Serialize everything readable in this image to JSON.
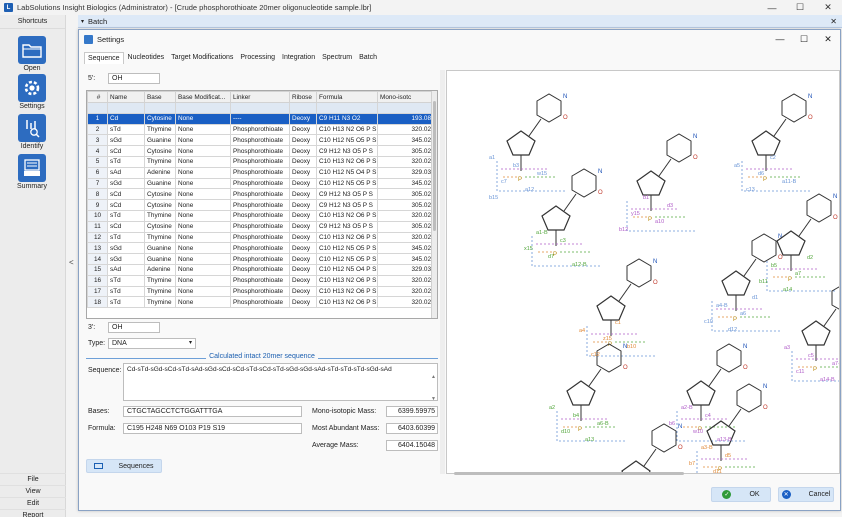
{
  "window": {
    "title": "LabSolutions Insight Biologics (Administrator) - [Crude phosphorothioate 20mer oligonucleotide sample.lbr]",
    "controls": [
      "—",
      "☐",
      "✕"
    ]
  },
  "sidebar": {
    "header": "Shortcuts",
    "items": [
      {
        "label": "Open",
        "icon": "folder-icon"
      },
      {
        "label": "Settings",
        "icon": "gear-icon"
      },
      {
        "label": "Identify",
        "icon": "identify-icon"
      },
      {
        "label": "Summary",
        "icon": "summary-icon"
      }
    ],
    "collapse_glyph": "<",
    "menu": [
      "File",
      "View",
      "Edit",
      "Report"
    ]
  },
  "batch_bar": {
    "label": "Batch",
    "close": "✕"
  },
  "dialog": {
    "title": "Settings",
    "tabs": [
      "Sequence",
      "Nucleotides",
      "Target Modifications",
      "Processing",
      "Integration",
      "Spectrum",
      "Batch"
    ],
    "five_prime": {
      "label": "5':",
      "value": "OH"
    },
    "three_prime": {
      "label": "3':",
      "value": "OH"
    },
    "type": {
      "label": "Type:",
      "value": "DNA"
    },
    "table": {
      "columns": [
        "#",
        "Name",
        "Base",
        "Base Modificat...",
        "Linker",
        "Ribose",
        "Formula",
        "Mono-isotc"
      ],
      "rows": [
        [
          "1",
          "Cd",
          "Cytosine",
          "None",
          "----",
          "Deoxy",
          "C9 H11 N3 O2",
          "193.08"
        ],
        [
          "2",
          "sTd",
          "Thymine",
          "None",
          "Phosphorothioate",
          "Deoxy",
          "C10 H13 N2 O6 P S",
          "320.02"
        ],
        [
          "3",
          "sGd",
          "Guanine",
          "None",
          "Phosphorothioate",
          "Deoxy",
          "C10 H12 N5 O5 P S",
          "345.02"
        ],
        [
          "4",
          "sCd",
          "Cytosine",
          "None",
          "Phosphorothioate",
          "Deoxy",
          "C9 H12 N3 O5 P S",
          "305.02"
        ],
        [
          "5",
          "sTd",
          "Thymine",
          "None",
          "Phosphorothioate",
          "Deoxy",
          "C10 H13 N2 O6 P S",
          "320.02"
        ],
        [
          "6",
          "sAd",
          "Adenine",
          "None",
          "Phosphorothioate",
          "Deoxy",
          "C10 H12 N5 O4 P S",
          "329.03"
        ],
        [
          "7",
          "sGd",
          "Guanine",
          "None",
          "Phosphorothioate",
          "Deoxy",
          "C10 H12 N5 O5 P S",
          "345.02"
        ],
        [
          "8",
          "sCd",
          "Cytosine",
          "None",
          "Phosphorothioate",
          "Deoxy",
          "C9 H12 N3 O5 P S",
          "305.02"
        ],
        [
          "9",
          "sCd",
          "Cytosine",
          "None",
          "Phosphorothioate",
          "Deoxy",
          "C9 H12 N3 O5 P S",
          "305.02"
        ],
        [
          "10",
          "sTd",
          "Thymine",
          "None",
          "Phosphorothioate",
          "Deoxy",
          "C10 H13 N2 O6 P S",
          "320.02"
        ],
        [
          "11",
          "sCd",
          "Cytosine",
          "None",
          "Phosphorothioate",
          "Deoxy",
          "C9 H12 N3 O5 P S",
          "305.02"
        ],
        [
          "12",
          "sTd",
          "Thymine",
          "None",
          "Phosphorothioate",
          "Deoxy",
          "C10 H13 N2 O6 P S",
          "320.02"
        ],
        [
          "13",
          "sGd",
          "Guanine",
          "None",
          "Phosphorothioate",
          "Deoxy",
          "C10 H12 N5 O5 P S",
          "345.02"
        ],
        [
          "14",
          "sGd",
          "Guanine",
          "None",
          "Phosphorothioate",
          "Deoxy",
          "C10 H12 N5 O5 P S",
          "345.02"
        ],
        [
          "15",
          "sAd",
          "Adenine",
          "None",
          "Phosphorothioate",
          "Deoxy",
          "C10 H12 N5 O4 P S",
          "329.03"
        ],
        [
          "16",
          "sTd",
          "Thymine",
          "None",
          "Phosphorothioate",
          "Deoxy",
          "C10 H13 N2 O6 P S",
          "320.02"
        ],
        [
          "17",
          "sTd",
          "Thymine",
          "None",
          "Phosphorothioate",
          "Deoxy",
          "C10 H13 N2 O6 P S",
          "320.02"
        ],
        [
          "18",
          "sTd",
          "Thymine",
          "None",
          "Phosphorothioate",
          "Deoxy",
          "C10 H13 N2 O6 P S",
          "320.02"
        ]
      ]
    },
    "section_caption": "Calculated intact 20mer sequence",
    "sequence": {
      "label": "Sequence:",
      "value": "Cd-sTd-sGd-sCd-sTd-sAd-sGd-sCd-sCd-sTd-sCd-sTd-sGd-sGd-sAd-sTd-sTd-sTd-sGd-sAd"
    },
    "bases": {
      "label": "Bases:",
      "value": "CTGCTAGCCTCTGGATTTGA"
    },
    "formula": {
      "label": "Formula:",
      "value": "C195 H248 N69 O103 P19 S19"
    },
    "mono_mass": {
      "label": "Mono-isotopic Mass:",
      "value": "6399.59975"
    },
    "abundant_mass": {
      "label": "Most Abundant Mass:",
      "value": "6403.60399"
    },
    "average_mass": {
      "label": "Average Mass:",
      "value": "6404.15048"
    },
    "sequences_button": "Sequences",
    "ok_button": "OK",
    "cancel_button": "Cancel"
  },
  "structure_labels": [
    "a1",
    "a1-B",
    "b1",
    "c1",
    "d1",
    "a2",
    "a2-B",
    "b2",
    "c2",
    "d2",
    "a3",
    "a3-B",
    "b3",
    "c3",
    "d3",
    "a4",
    "a4-B",
    "b4",
    "c4",
    "d4",
    "a5",
    "b5",
    "c5",
    "d5",
    "w15",
    "x15",
    "y15",
    "z15",
    "a6",
    "a6-B",
    "b6",
    "c6",
    "d6",
    "a7",
    "a7-B",
    "b7",
    "c7",
    "d7",
    "a10",
    "b10",
    "c10",
    "d10",
    "w10",
    "a11",
    "a11-B",
    "b11",
    "c11",
    "d11",
    "a12",
    "a12-B",
    "b12",
    "c12",
    "d12",
    "a13",
    "a13-B",
    "b13",
    "c13",
    "a14",
    "a14-B",
    "a15",
    "b15"
  ],
  "colors": {
    "accent": "#1a5fc4",
    "selected_row": "#1a5fc4",
    "dash_blue": "#6a95d6",
    "dash_green": "#53a63c",
    "dash_purple": "#b05cc8",
    "dash_orange": "#e08a3a"
  }
}
